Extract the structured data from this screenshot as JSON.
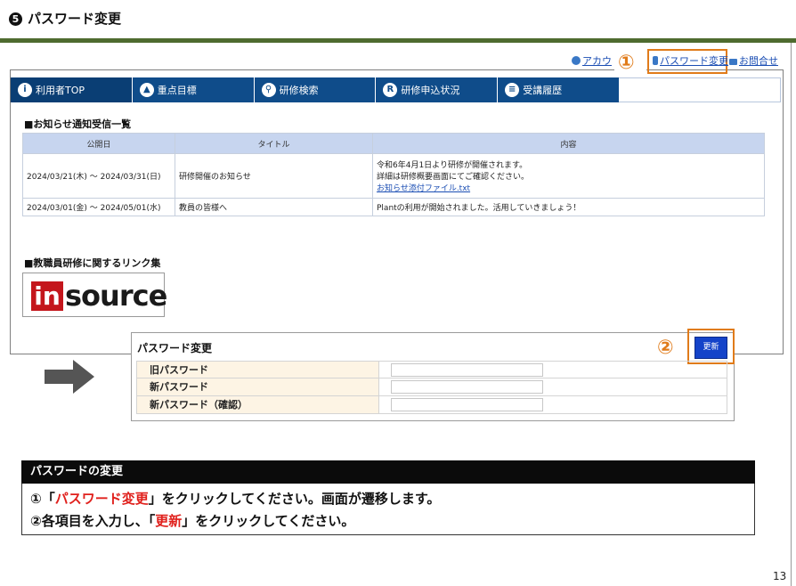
{
  "slide": {
    "step_number": "5",
    "title": "パスワード変更",
    "page_number": "13"
  },
  "top_links": {
    "account": "アカウ",
    "password_change": "パスワード変更",
    "contact": "お問合せ"
  },
  "markers": {
    "one": "①",
    "two": "②"
  },
  "nav": [
    {
      "label": "利用者TOP",
      "icon": "info-icon"
    },
    {
      "label": "重点目標",
      "icon": "chart-icon"
    },
    {
      "label": "研修検索",
      "icon": "search-person-icon"
    },
    {
      "label": "研修申込状況",
      "icon": "application-icon"
    },
    {
      "label": "受講履歴",
      "icon": "history-icon"
    }
  ],
  "notices": {
    "title": "■お知らせ通知受信一覧",
    "headers": [
      "公開日",
      "タイトル",
      "内容"
    ],
    "rows": [
      {
        "date": "2024/03/21(木) ～ 2024/03/31(日)",
        "title": "研修開催のお知らせ",
        "content_line1": "令和6年4月1日より研修が開催されます。",
        "content_line2": "詳細は研修概要画面にてご確認ください。",
        "attachment": "お知らせ添付ファイル.txt"
      },
      {
        "date": "2024/03/01(金) ～ 2024/05/01(水)",
        "title": "教員の皆様へ",
        "content_line1": "Plantの利用が開始されました。活用していきましょう！"
      }
    ]
  },
  "links_section": {
    "title": "■教職員研修に関するリンク集",
    "logo_in": "in",
    "logo_rest": "source"
  },
  "password_form": {
    "title": "パスワード変更",
    "update_button": "更新",
    "fields": [
      {
        "label": "旧パスワード",
        "value": ""
      },
      {
        "label": "新パスワード",
        "value": ""
      },
      {
        "label": "新パスワード（確認）",
        "value": ""
      }
    ]
  },
  "caption": {
    "heading": "パスワードの変更",
    "line1_prefix": "①「",
    "line1_highlight": "パスワード変更",
    "line1_suffix": "」をクリックしてください。画面が遷移します。",
    "line2_prefix": "②各項目を入力し、「",
    "line2_highlight": "更新",
    "line2_suffix": "」をクリックしてください。"
  },
  "colors": {
    "rule": "#4e6b2f",
    "nav": "#0f4c8a",
    "highlight": "#e07b1a",
    "emphasis": "#e0201c",
    "update_button": "#1443c9"
  }
}
